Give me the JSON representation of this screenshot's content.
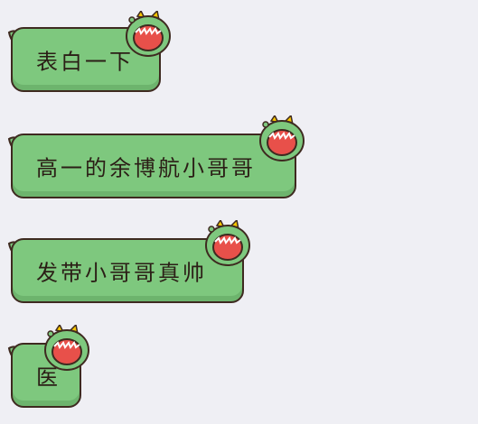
{
  "chat": {
    "messages": [
      {
        "text": "表白一下"
      },
      {
        "text": "高一的余博航小哥哥"
      },
      {
        "text": "发带小哥哥真帅"
      },
      {
        "text": "医"
      }
    ]
  },
  "colors": {
    "background": "#efeff4",
    "bubble_fill": "#7ec87e",
    "bubble_border": "#3e2a20",
    "monster_mouth": "#e8504a",
    "monster_horn": "#f5c400"
  },
  "icons": {
    "bubble_decoration": "green-monster-icon"
  }
}
